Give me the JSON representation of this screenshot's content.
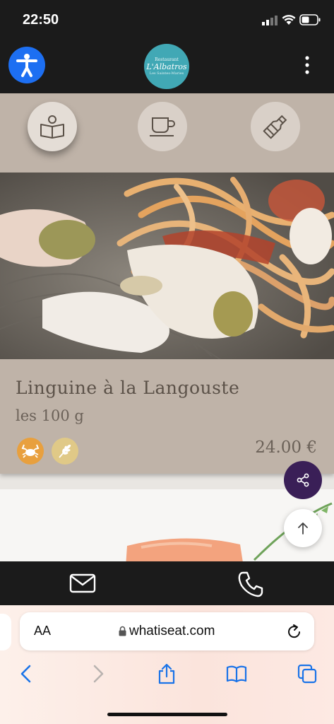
{
  "status": {
    "time": "22:50"
  },
  "app": {
    "logo": {
      "line1": "Restaurant",
      "line2": "L'Albatros",
      "line3": "Les Saintes-Maries"
    }
  },
  "categories": [
    {
      "name": "menu",
      "icon": "open-book-icon",
      "active": true
    },
    {
      "name": "drinks",
      "icon": "coffee-cup-icon",
      "active": false
    },
    {
      "name": "wine",
      "icon": "bottle-icon",
      "active": false
    }
  ],
  "dish": {
    "title": "Linguine à la Langouste",
    "subtitle": "les 100 g",
    "price": "24.00 €",
    "allergens": [
      {
        "icon": "crab-icon",
        "color": "#e8a03e"
      },
      {
        "icon": "wheat-icon",
        "color": "#e0c987"
      }
    ]
  },
  "browser": {
    "aa_label": "AA",
    "host": "whatiseat.com"
  },
  "colors": {
    "accent_purple": "#3a1f57",
    "accessibility_blue": "#1d6ff2",
    "logo_teal": "#41a8b5",
    "card_beige": "#bfb3a8",
    "ios_blue": "#1a73e8"
  }
}
